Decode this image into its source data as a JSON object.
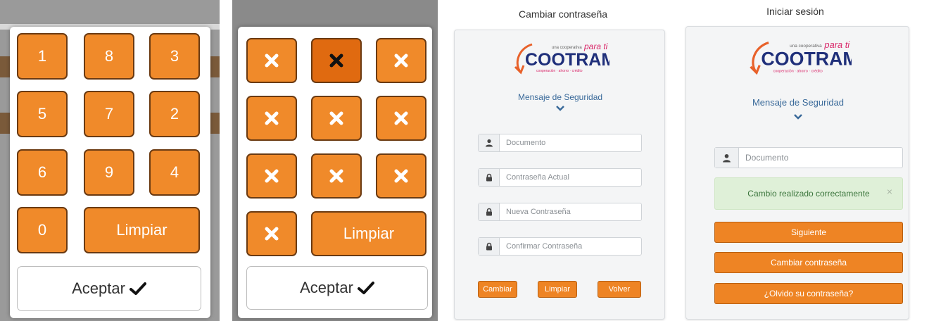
{
  "keypad_numbers": {
    "keys": [
      "1",
      "8",
      "3",
      "5",
      "7",
      "2",
      "6",
      "9",
      "4",
      "0"
    ],
    "clear_label": "Limpiar",
    "accept_label": "Aceptar"
  },
  "keypad_masked": {
    "mask_icon": "close-icon",
    "clear_label": "Limpiar",
    "accept_label": "Aceptar"
  },
  "change_password": {
    "heading": "Cambiar contraseña",
    "logo": {
      "tagline": "una cooperativa",
      "slogan": "para ti",
      "name": "COOTRAMED",
      "sub": "cooperación · ahorro · crédito"
    },
    "security_message": "Mensaje de Seguridad",
    "fields": {
      "document": "Documento",
      "current_password": "Contraseña Actual",
      "new_password": "Nueva Contraseña",
      "confirm_password": "Confirmar Contraseña"
    },
    "buttons": {
      "change": "Cambiar",
      "clear": "Limpiar",
      "back": "Volver"
    }
  },
  "login": {
    "heading": "Iniciar sesión",
    "logo": {
      "tagline": "una cooperativa",
      "slogan": "para ti",
      "name": "COOTRAMED",
      "sub": "cooperación · ahorro · crédito"
    },
    "security_message": "Mensaje de Seguridad",
    "document_placeholder": "Documento",
    "alert": "Cambio realizado correctamente",
    "alert_close": "×",
    "buttons": {
      "next": "Siguiente",
      "change_password": "Cambiar contraseña",
      "forgot": "¿Olvido su contraseña?"
    }
  },
  "colors": {
    "accent": "#ee8424",
    "accent_dark": "#e06a10",
    "link_blue": "#3a6a9a",
    "success_bg": "#dff0d8",
    "success_text": "#3c763d"
  }
}
